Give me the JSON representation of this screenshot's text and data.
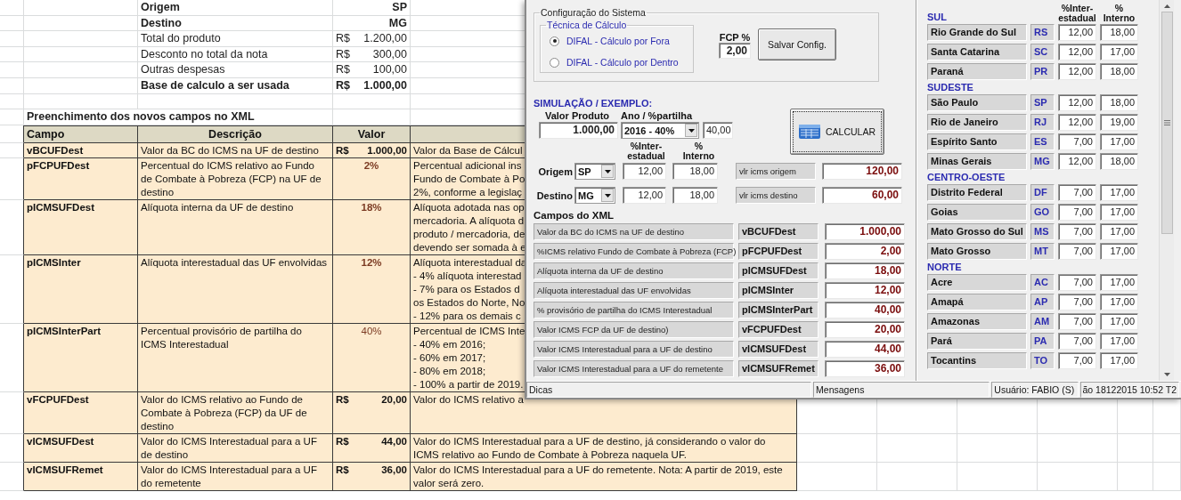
{
  "sheet": {
    "summary_rows": [
      {
        "label": "Origem",
        "value": "SP",
        "bold": true
      },
      {
        "label": "Destino",
        "value": "MG",
        "bold": true
      },
      {
        "label": "Total do produto",
        "currency": "R$",
        "value": "1.200,00",
        "bold": false
      },
      {
        "label": "Desconto no total da nota",
        "currency": "R$",
        "value": "300,00",
        "bold": false
      },
      {
        "label": "Outras despesas",
        "currency": "R$",
        "value": "100,00",
        "bold": false
      },
      {
        "label": "Base de calculo a ser usada",
        "currency": "R$",
        "value": "1.000,00",
        "bold": true
      }
    ],
    "section_title": "Preenchimento dos novos campos no XML",
    "columns": [
      "Campo",
      "Descrição",
      "Valor"
    ],
    "rows": [
      {
        "campo": "vBCUFDest",
        "descricao": "Valor da BC do ICMS na UF de destino",
        "kind": "currency",
        "currency": "R$",
        "valor": "1.000,00",
        "bold": true,
        "note": "Valor da Base de Cálcul"
      },
      {
        "campo": "pFCPUFDest",
        "descricao": "Percentual do ICMS relativo ao Fundo\nde Combate à Pobreza (FCP) na UF de\ndestino",
        "kind": "percent",
        "valor": "2%",
        "bold": true,
        "note": "Percentual adicional ins\nFundo de Combate à Po\n2%, conforme a legislaç"
      },
      {
        "campo": "pICMSUFDest",
        "descricao": "Alíquota interna da UF de destino",
        "kind": "percent",
        "valor": "18%",
        "bold": true,
        "note": "Alíquota adotada nas op\nmercadoria. A alíquota d\nproduto / mercadoria, de\ndevendo ser somada à e"
      },
      {
        "campo": "pICMSInter",
        "descricao": "Alíquota interestadual das UF envolvidas",
        "kind": "percent",
        "valor": "12%",
        "bold": true,
        "note": "Alíquota interestadual da\n- 4% alíquota interestad\n- 7% para os Estados d\nos Estados do Norte, No\n- 12% para os demais c"
      },
      {
        "campo": "pICMSInterPart",
        "descricao": "Percentual provisório de partilha do\nICMS Interestadual",
        "kind": "percent",
        "valor": "40%",
        "bold": false,
        "note": "Percentual de ICMS Inte\n- 40% em 2016;\n- 60% em 2017;\n- 80% em 2018;\n- 100% a partir de 2019."
      },
      {
        "campo": "vFCPUFDest",
        "descricao": "Valor do ICMS relativo ao Fundo de\nCombate à Pobreza (FCP) da UF de\ndestino",
        "kind": "currency",
        "currency": "R$",
        "valor": "20,00",
        "bold": true,
        "note": "Valor do ICMS relativo a"
      },
      {
        "campo": "vICMSUFDest",
        "descricao": "Valor do ICMS Interestadual para a UF\nde destino",
        "kind": "currency",
        "currency": "R$",
        "valor": "44,00",
        "bold": true,
        "note": "Valor do ICMS Interestadual para a UF de destino, já considerando o valor do\nICMS relativo ao Fundo de Combate à Pobreza naquela UF."
      },
      {
        "campo": "vICMSUFRemet",
        "descricao": "Valor do ICMS Interestadual para a UF\ndo remetente",
        "kind": "currency",
        "currency": "R$",
        "valor": "36,00",
        "bold": true,
        "note": "Valor do ICMS Interestadual para a UF do remetente. Nota: A partir de 2019, este\nvalor será zero."
      }
    ]
  },
  "window": {
    "config": {
      "title": "Configuração do Sistema",
      "technique_title": "Técnica de Cálculo",
      "options": [
        {
          "label": "DIFAL - Cálculo por Fora",
          "selected": true
        },
        {
          "label": "DIFAL - Cálculo por Dentro",
          "selected": false
        }
      ],
      "fcp_label": "FCP %",
      "fcp_value": "2,00",
      "save_button": "Salvar Config."
    },
    "simulation": {
      "title": "SIMULAÇÃO /  EXEMPLO:",
      "product_label": "Valor Produto",
      "product_value": "1.000,00",
      "year_label": "Ano / %partilha",
      "year_value": "2016 - 40%",
      "share_value": "40,00",
      "calc_button": "CALCULAR",
      "headings": [
        "%Inter-\nestadual",
        "%\nInterno"
      ],
      "ufs": [
        {
          "label": "Origem",
          "uf": "SP",
          "inter": "12,00",
          "interno": "18,00",
          "result_label": "vlr icms origem",
          "result": "120,00"
        },
        {
          "label": "Destino",
          "uf": "MG",
          "inter": "12,00",
          "interno": "18,00",
          "result_label": "vlr icms destino",
          "result": "60,00"
        }
      ]
    },
    "xml": {
      "title": "Campos do XML",
      "rows": [
        {
          "description": "Valor da BC do ICMS na UF de destino",
          "code": "vBCUFDest",
          "value": "1.000,00"
        },
        {
          "description": "%ICMS relativo Fundo de Combate à Pobreza (FCP)",
          "code": "pFCPUFDest",
          "value": "2,00"
        },
        {
          "description": "Alíquota interna da UF de destino",
          "code": "pICMSUFDest",
          "value": "18,00"
        },
        {
          "description": "Alíquota interestadual das UF envolvidas",
          "code": "pICMSInter",
          "value": "12,00"
        },
        {
          "description": "% provisório de partilha do ICMS Interestadual",
          "code": "pICMSInterPart",
          "value": "40,00"
        },
        {
          "description": "Valor ICMS FCP da UF de destino)",
          "code": "vFCPUFDest",
          "value": "20,00"
        },
        {
          "description": "Valor ICMS Interestadual para a UF de destino",
          "code": "vICMSUFDest",
          "value": "44,00"
        },
        {
          "description": "Valor ICMS Interestadual para a UF do remetente",
          "code": "vICMSUFRemet",
          "value": "36,00"
        }
      ]
    },
    "states": {
      "headings": [
        "%Inter-\nestadual",
        "%\nInterno"
      ],
      "regions": [
        {
          "name": "SUL",
          "states": [
            {
              "name": "Rio Grande do Sul",
              "uf": "RS",
              "inter": "12,00",
              "interno": "18,00"
            },
            {
              "name": "Santa Catarina",
              "uf": "SC",
              "inter": "12,00",
              "interno": "17,00"
            },
            {
              "name": "Paraná",
              "uf": "PR",
              "inter": "12,00",
              "interno": "18,00"
            }
          ]
        },
        {
          "name": "SUDESTE",
          "states": [
            {
              "name": "São Paulo",
              "uf": "SP",
              "inter": "12,00",
              "interno": "18,00"
            },
            {
              "name": "Rio de Janeiro",
              "uf": "RJ",
              "inter": "12,00",
              "interno": "19,00"
            },
            {
              "name": "Espírito Santo",
              "uf": "ES",
              "inter": "7,00",
              "interno": "17,00"
            },
            {
              "name": "Minas Gerais",
              "uf": "MG",
              "inter": "12,00",
              "interno": "18,00"
            }
          ]
        },
        {
          "name": "CENTRO-OESTE",
          "states": [
            {
              "name": "Distrito Federal",
              "uf": "DF",
              "inter": "7,00",
              "interno": "17,00"
            },
            {
              "name": "Goias",
              "uf": "GO",
              "inter": "7,00",
              "interno": "17,00"
            },
            {
              "name": "Mato Grosso do Sul",
              "uf": "MS",
              "inter": "7,00",
              "interno": "17,00"
            },
            {
              "name": "Mato Grosso",
              "uf": "MT",
              "inter": "7,00",
              "interno": "17,00"
            }
          ]
        },
        {
          "name": "NORTE",
          "states": [
            {
              "name": "Acre",
              "uf": "AC",
              "inter": "7,00",
              "interno": "17,00"
            },
            {
              "name": "Amapá",
              "uf": "AP",
              "inter": "7,00",
              "interno": "17,00"
            },
            {
              "name": "Amazonas",
              "uf": "AM",
              "inter": "7,00",
              "interno": "17,00"
            },
            {
              "name": "Pará",
              "uf": "PA",
              "inter": "7,00",
              "interno": "17,00"
            },
            {
              "name": "Tocantins",
              "uf": "TO",
              "inter": "7,00",
              "interno": "17,00"
            }
          ]
        }
      ]
    },
    "status_bar": [
      "Dicas",
      "Mensagens",
      "Usuário: FABIO (S)",
      "ão 18122015 10:52 T2"
    ]
  }
}
